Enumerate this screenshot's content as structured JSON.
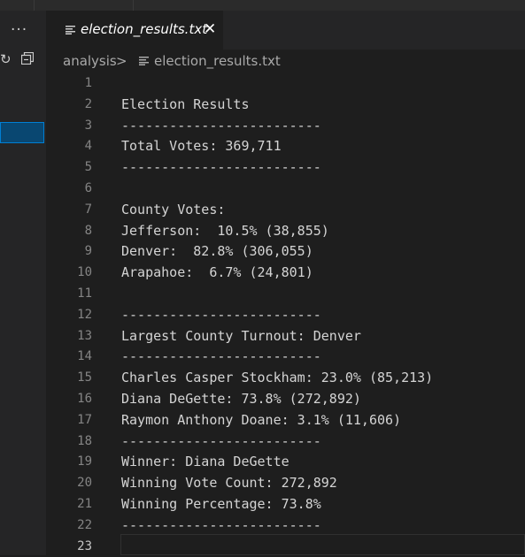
{
  "sidebar": {
    "more_label": "···"
  },
  "tab": {
    "filename": "election_results.txt",
    "close_label": "✕"
  },
  "breadcrumb": {
    "folder": "analysis",
    "separator": ">",
    "file": "election_results.txt"
  },
  "editor": {
    "line_numbers": [
      "1",
      "2",
      "3",
      "4",
      "5",
      "6",
      "7",
      "8",
      "9",
      "10",
      "11",
      "12",
      "13",
      "14",
      "15",
      "16",
      "17",
      "18",
      "19",
      "20",
      "21",
      "22",
      "23"
    ],
    "lines": [
      "",
      "Election Results",
      "-------------------------",
      "Total Votes: 369,711",
      "-------------------------",
      "",
      "County Votes:",
      "Jefferson:  10.5% (38,855)",
      "Denver:  82.8% (306,055)",
      "Arapahoe:  6.7% (24,801)",
      "",
      "-------------------------",
      "Largest County Turnout: Denver",
      "-------------------------",
      "Charles Casper Stockham: 23.0% (85,213)",
      "Diana DeGette: 73.8% (272,892)",
      "Raymon Anthony Doane: 3.1% (11,606)",
      "-------------------------",
      "Winner: Diana DeGette",
      "Winning Vote Count: 272,892",
      "Winning Percentage: 73.8%",
      "-------------------------",
      ""
    ]
  }
}
